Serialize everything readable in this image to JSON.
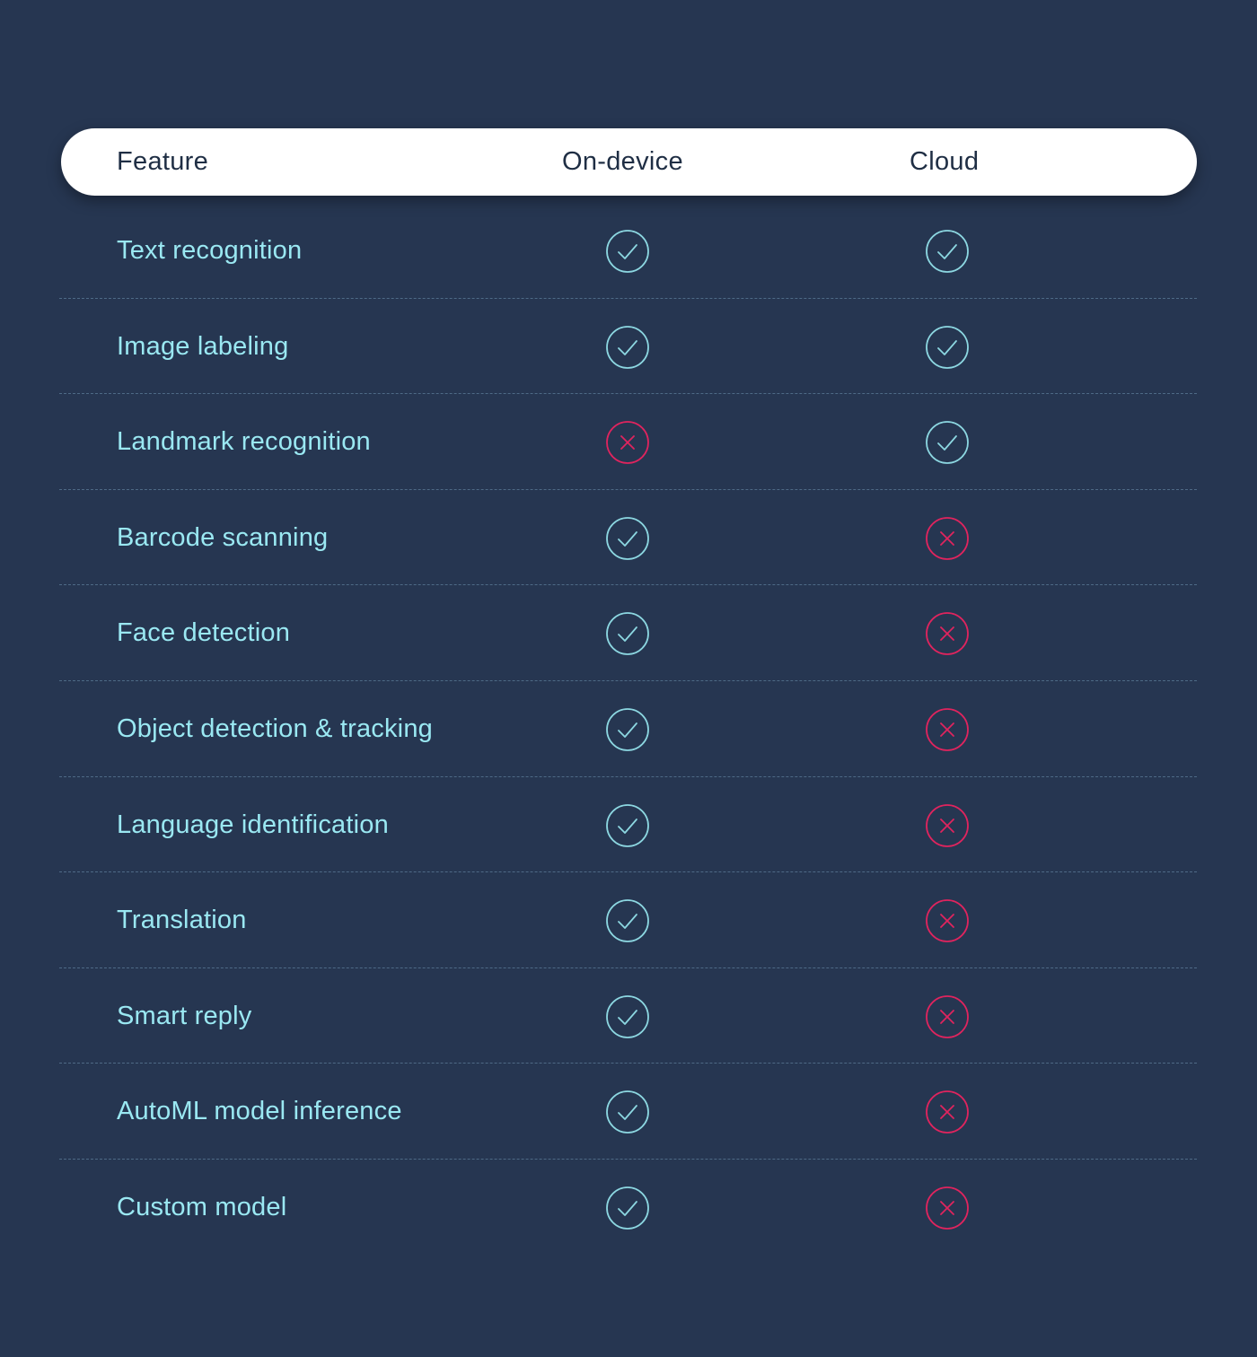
{
  "colors": {
    "background": "#263651",
    "header_bg": "#ffffff",
    "header_text": "#1f2e44",
    "feature_text": "#9ae8f2",
    "check": "#8cd7e1",
    "cross": "#e0245e",
    "divider": "#4e6a86"
  },
  "header": {
    "feature": "Feature",
    "on_device": "On-device",
    "cloud": "Cloud"
  },
  "rows": [
    {
      "feature": "Text recognition",
      "on_device": true,
      "cloud": true
    },
    {
      "feature": "Image labeling",
      "on_device": true,
      "cloud": true
    },
    {
      "feature": "Landmark recognition",
      "on_device": false,
      "cloud": true
    },
    {
      "feature": "Barcode scanning",
      "on_device": true,
      "cloud": false
    },
    {
      "feature": "Face detection",
      "on_device": true,
      "cloud": false
    },
    {
      "feature": "Object detection & tracking",
      "on_device": true,
      "cloud": false
    },
    {
      "feature": "Language identification",
      "on_device": true,
      "cloud": false
    },
    {
      "feature": "Translation",
      "on_device": true,
      "cloud": false
    },
    {
      "feature": "Smart reply",
      "on_device": true,
      "cloud": false
    },
    {
      "feature": "AutoML model inference",
      "on_device": true,
      "cloud": false
    },
    {
      "feature": "Custom model",
      "on_device": true,
      "cloud": false
    }
  ],
  "icons": {
    "supported": "check-circle-icon",
    "unsupported": "x-circle-icon"
  }
}
